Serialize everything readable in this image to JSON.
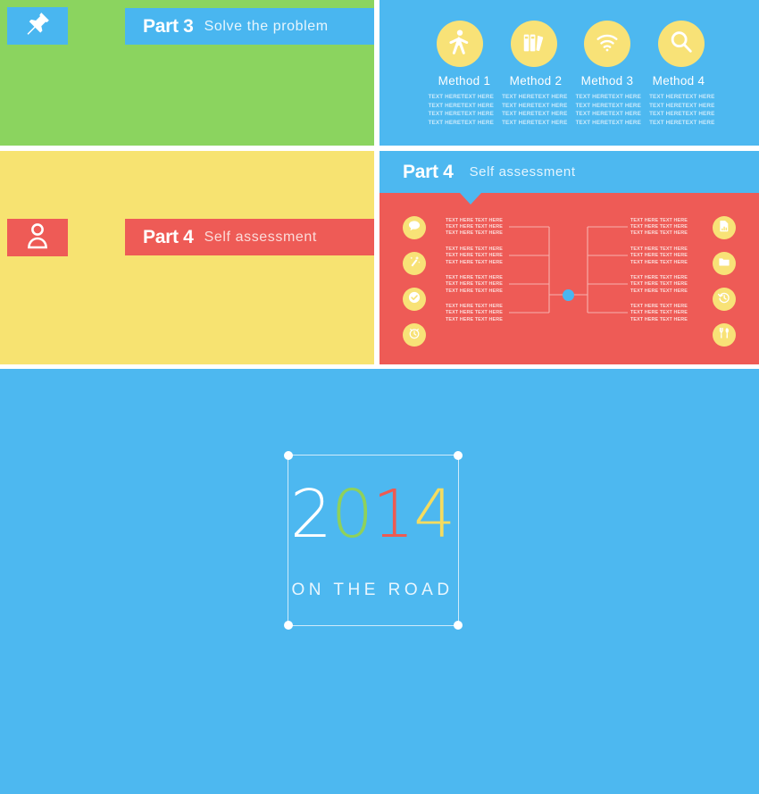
{
  "colors": {
    "blue": "#4DB8F0",
    "green": "#8BD45F",
    "yellow_panel": "#F7E371",
    "red": "#EE5B56",
    "icon_yellow": "#F8E277",
    "white": "#FFFFFF",
    "year_2": "#FFFFFF",
    "year_0": "#8FD15B",
    "year_1": "#EE5A52",
    "year_4": "#F5DC5F"
  },
  "slide_green": {
    "badge_icon": "pushpin-icon",
    "part_number": "Part 3",
    "part_subtitle": "Solve the problem"
  },
  "slide_methods": {
    "icons": [
      "accessibility-person-icon",
      "books-icon",
      "wifi-icon",
      "search-icon"
    ],
    "labels": [
      "Method 1",
      "Method 2",
      "Method 3",
      "Method 4"
    ],
    "body_line": "TEXT HERETEXT HERE",
    "body_rows": 4,
    "columns": 4
  },
  "slide_yellow": {
    "badge_icon": "person-icon",
    "part_number": "Part 4",
    "part_subtitle": "Self assessment"
  },
  "slide_diagram": {
    "header_part_number": "Part 4",
    "header_part_subtitle": "Self assessment",
    "left_icons": [
      "speech-bubble-icon",
      "magic-wand-icon",
      "check-circle-icon",
      "alarm-clock-icon"
    ],
    "right_icons": [
      "report-document-icon",
      "folder-icon",
      "clock-history-icon",
      "cutlery-icon"
    ],
    "text_line_a": "TEXT HERE  TEXT HERE",
    "text_line_b": "TEXT HERE TEXT HERE",
    "text_line_c": "TEXT HERE TEXT HERE",
    "blocks_per_side": 4
  },
  "slide_cover": {
    "year_digits": [
      {
        "char": "2",
        "color": "#FFFFFF"
      },
      {
        "char": "0",
        "color": "#8FD15B"
      },
      {
        "char": "1",
        "color": "#EE5A52"
      },
      {
        "char": "4",
        "color": "#F5DC5F"
      }
    ],
    "year_text": "2014",
    "tagline": "ON THE ROAD"
  }
}
